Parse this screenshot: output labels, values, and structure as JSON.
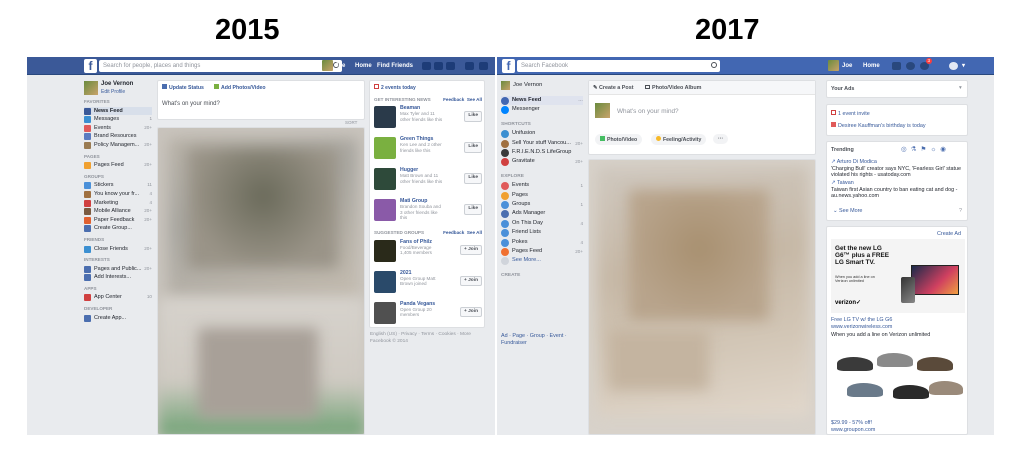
{
  "labels": {
    "left": "2015",
    "right": "2017"
  },
  "fb2015": {
    "search_placeholder": "Search for people, places and things",
    "user": "Joe",
    "nav": [
      "Home",
      "Find Friends"
    ],
    "profile": {
      "name": "Joe Vernon",
      "edit": "Edit Profile"
    },
    "sidebar": [
      {
        "type": "hd",
        "label": "Favorites"
      },
      {
        "type": "it",
        "label": "News Feed",
        "sel": true,
        "color": "#3b5998"
      },
      {
        "type": "it",
        "label": "Messages",
        "count": "1",
        "color": "#3b8fd1"
      },
      {
        "type": "it",
        "label": "Events",
        "count": "20+",
        "color": "#e05a5a"
      },
      {
        "type": "it",
        "label": "Brand Resources",
        "color": "#5b7bc0"
      },
      {
        "type": "it",
        "label": "Policy Managem...",
        "count": "20+",
        "color": "#9a7b52"
      },
      {
        "type": "hd",
        "label": "Pages"
      },
      {
        "type": "it",
        "label": "Pages Feed",
        "count": "20+",
        "color": "#f0a030"
      },
      {
        "type": "hd",
        "label": "Groups"
      },
      {
        "type": "it",
        "label": "Stickers",
        "count": "11",
        "color": "#4a90d9"
      },
      {
        "type": "it",
        "label": "You know your fr...",
        "count": "4",
        "color": "#a07040"
      },
      {
        "type": "it",
        "label": "Marketing",
        "count": "4",
        "color": "#d04040"
      },
      {
        "type": "it",
        "label": "Mobile Alliance",
        "count": "20+",
        "color": "#7a5a40"
      },
      {
        "type": "it",
        "label": "Paper Feedback",
        "count": "20+",
        "color": "#e06030"
      },
      {
        "type": "it",
        "label": "Create Group...",
        "color": "#4b6eaf"
      },
      {
        "type": "hd",
        "label": "Friends"
      },
      {
        "type": "it",
        "label": "Close Friends",
        "count": "20+",
        "color": "#3b8fd1"
      },
      {
        "type": "hd",
        "label": "Interests"
      },
      {
        "type": "it",
        "label": "Pages and Public...",
        "count": "20+",
        "color": "#4b6eaf"
      },
      {
        "type": "it",
        "label": "Add Interests...",
        "color": "#4b6eaf"
      },
      {
        "type": "hd",
        "label": "Apps"
      },
      {
        "type": "it",
        "label": "App Center",
        "count": "10",
        "color": "#d04040"
      },
      {
        "type": "hd",
        "label": "Developer"
      },
      {
        "type": "it",
        "label": "Create App...",
        "color": "#4b6eaf"
      }
    ],
    "composer": {
      "update": "Update Status",
      "photo": "Add Photos/Video",
      "prompt": "What's on your mind?",
      "sort": "SORT"
    },
    "events_today": "2 events today",
    "interesting_header": "Get Interesting News",
    "feedback": "Feedback",
    "see_all": "See All",
    "pages": [
      {
        "name": "Beaman",
        "desc": "Max Tyler and 11 other friends like this",
        "btn": "Like",
        "color": "#2a3a4a"
      },
      {
        "name": "Green Things",
        "desc": "Ken Lee and 2 other friends like this",
        "btn": "Like",
        "color": "#7ab040"
      },
      {
        "name": "Hugger",
        "desc": "Matt Brown and 11 other friends like this",
        "btn": "Like",
        "color": "#2e4a3a"
      },
      {
        "name": "Mati Group",
        "desc": "Brandon Souba and 3 other friends like this",
        "btn": "Like",
        "color": "#8a5aa8"
      }
    ],
    "groups_header": "Suggested Groups",
    "groups": [
      {
        "name": "Fans of Philz",
        "desc": "Food/Beverage 1,405 members",
        "btn": "+ Join",
        "color": "#2a2a1a"
      },
      {
        "name": "2021",
        "desc": "Open Group Matt Brown joined",
        "btn": "+ Join",
        "color": "#2a4a6a"
      },
      {
        "name": "Panda Vegans",
        "desc": "Open Group 20 members",
        "btn": "+ Join",
        "color": "#505050"
      }
    ],
    "footer": [
      "English (US) · Privacy · Terms · Cookies · More",
      "Facebook © 2014"
    ]
  },
  "fb2017": {
    "search_placeholder": "Search Facebook",
    "user": "Joe",
    "nav": [
      "Home"
    ],
    "notification_count": "3",
    "profile": {
      "name": "Joe Vernon"
    },
    "sidebar": [
      {
        "type": "it",
        "label": "News Feed",
        "sel": true,
        "color": "#4267b2",
        "count": "···"
      },
      {
        "type": "it",
        "label": "Messenger",
        "color": "#0084ff"
      },
      {
        "type": "hd",
        "label": "Shortcuts"
      },
      {
        "type": "it",
        "label": "Unifusion",
        "color": "#3b8fd1"
      },
      {
        "type": "it",
        "label": "Sell Your stuff Vancou...",
        "count": "20+",
        "color": "#a07040"
      },
      {
        "type": "it",
        "label": "F.R.I.E.N.D.S LifeGroup",
        "color": "#3a3a3a"
      },
      {
        "type": "it",
        "label": "Gravitate",
        "count": "20+",
        "color": "#d04040"
      },
      {
        "type": "hd",
        "label": "Explore"
      },
      {
        "type": "it",
        "label": "Events",
        "count": "1",
        "color": "#e05a5a"
      },
      {
        "type": "it",
        "label": "Pages",
        "color": "#f0a030"
      },
      {
        "type": "it",
        "label": "Groups",
        "count": "1",
        "color": "#4a90d9"
      },
      {
        "type": "it",
        "label": "Ads Manager",
        "color": "#4b6eaf"
      },
      {
        "type": "it",
        "label": "On This Day",
        "count": "4",
        "color": "#4a90d9"
      },
      {
        "type": "it",
        "label": "Friend Lists",
        "color": "#4a90d9"
      },
      {
        "type": "it",
        "label": "Pokes",
        "count": "4",
        "color": "#4a90d9"
      },
      {
        "type": "it",
        "label": "Pages Feed",
        "count": "20+",
        "color": "#f07030"
      },
      {
        "type": "it",
        "label": "See More...",
        "color": "#d0d4db"
      },
      {
        "type": "hd",
        "label": "Create"
      }
    ],
    "create_links": "Ad · Page · Group · Event · Fundraiser",
    "composer": {
      "post": "Create a Post",
      "album": "Photo/Video Album",
      "prompt": "What's on your mind?",
      "photo": "Photo/Video",
      "feeling": "Feeling/Activity",
      "more": "···"
    },
    "your_ads": "Your Ads",
    "event_invite": "1 event invite",
    "birthday": "Desiree Kauffman's birthday is today",
    "trending": {
      "label": "Trending",
      "items": [
        {
          "title": "Arturo Di Modica",
          "text": "'Charging Bull' creator says NYC, 'Fearless Girl' statue violated his rights - usatoday.com"
        },
        {
          "title": "Taiwan",
          "text": "Taiwan first Asian country to ban eating cat and dog - au.news.yahoo.com"
        }
      ],
      "see_more": "See More"
    },
    "create_ad": "Create Ad",
    "ad1": {
      "headline": "Get the new LG G6™ plus a FREE LG Smart TV.",
      "sub": "When you add a line on Verizon unlimited",
      "brand": "verizon✓",
      "link": "Free LG TV w/ the LG G6",
      "url": "www.verizonwireless.com",
      "desc": "When you add a line on Verizon unlimited"
    },
    "ad2": {
      "price": "$29.99 - 57% off!",
      "url": "www.groupon.com"
    }
  }
}
